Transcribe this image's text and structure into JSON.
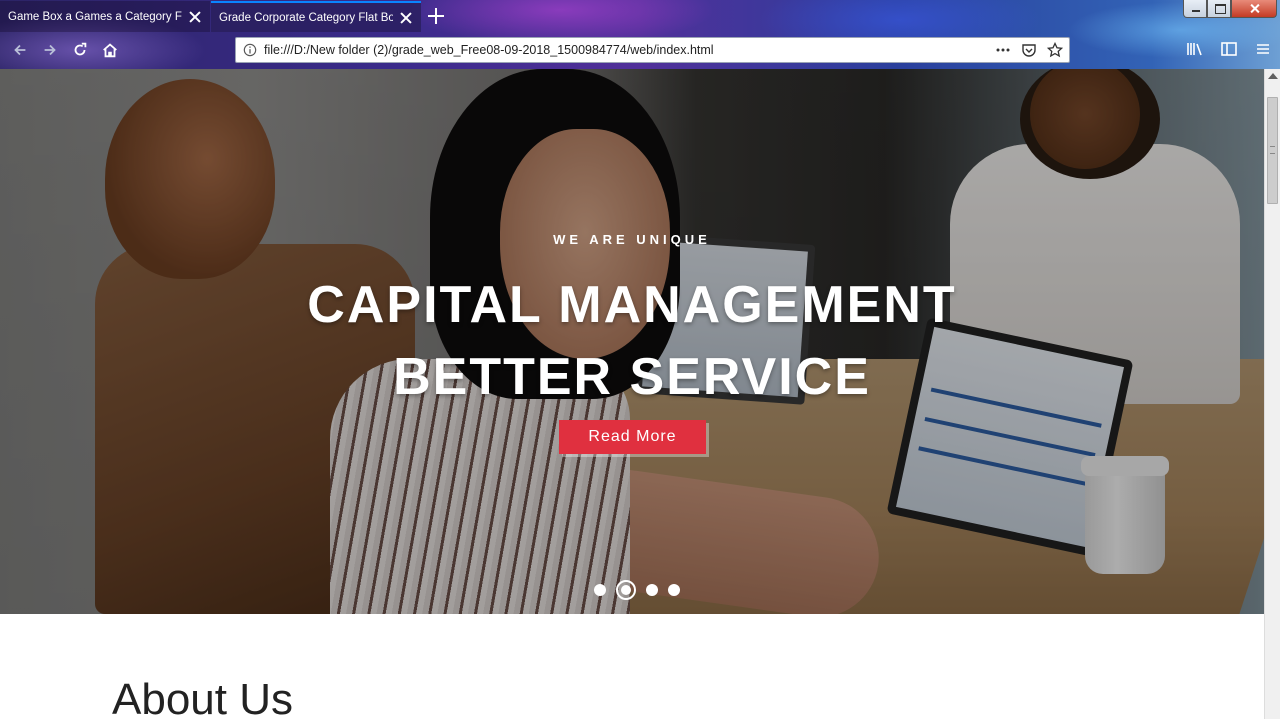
{
  "browser": {
    "tabs": [
      {
        "title": "Game Box a Games a Category Flat",
        "active": false
      },
      {
        "title": "Grade Corporate Category Flat Boo",
        "active": true
      }
    ],
    "address": "file:///D:/New folder (2)/grade_web_Free08-09-2018_1500984774/web/index.html",
    "icons": [
      "back-icon",
      "forward-icon",
      "reload-icon",
      "home-icon",
      "info-icon",
      "more-icon",
      "pocket-icon",
      "bookmark-star-icon",
      "library-icon",
      "sidebar-icon",
      "menu-icon"
    ]
  },
  "hero": {
    "eyebrow": "WE ARE UNIQUE",
    "headline_line1": "CAPITAL MANAGEMENT",
    "headline_line2": "BETTER SERVICE",
    "cta_label": "Read More",
    "slides": 4,
    "active_slide": 2,
    "accent_color": "#e0303f"
  },
  "sections": {
    "about_title": "About Us"
  }
}
